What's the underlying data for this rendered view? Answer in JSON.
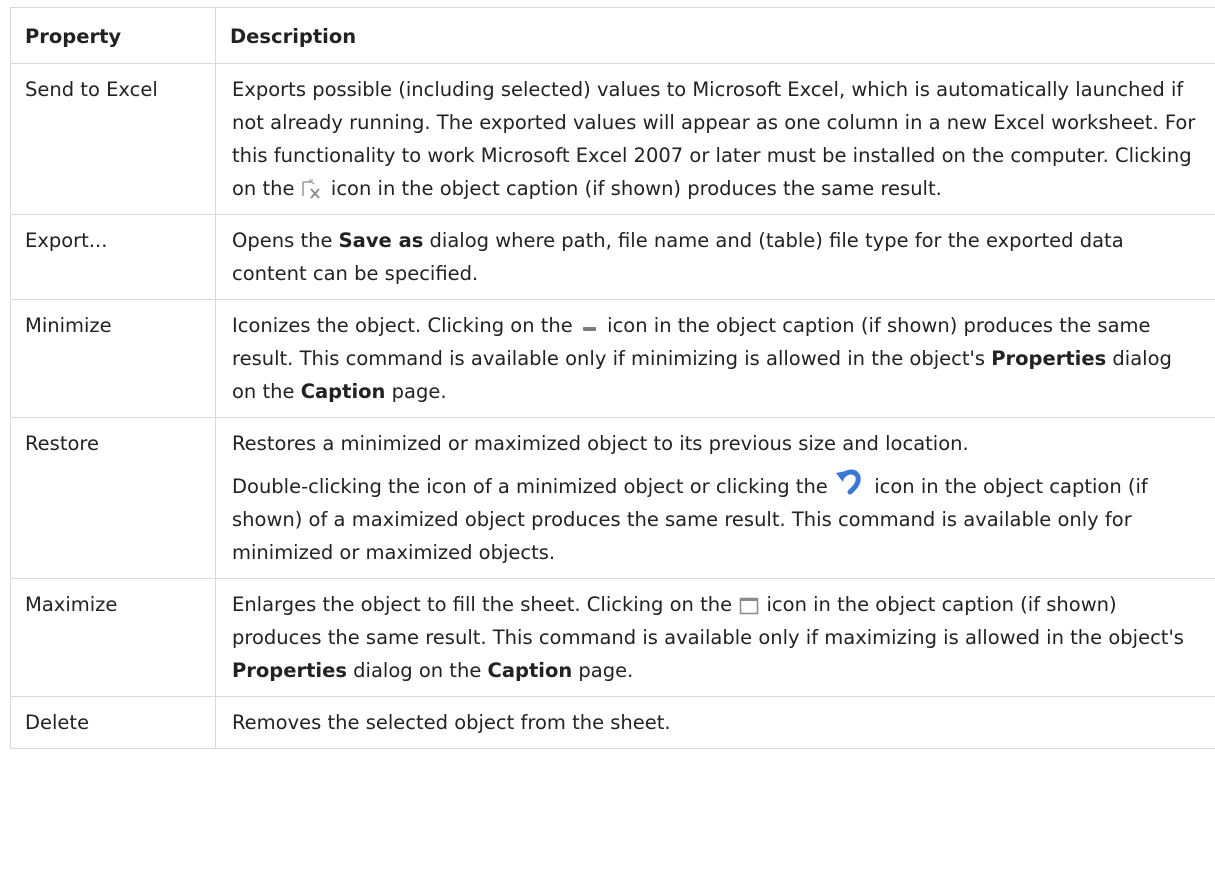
{
  "table": {
    "headers": {
      "property": "Property",
      "description": "Description"
    },
    "rows": [
      {
        "property": "Send to Excel",
        "text": [
          "Exports possible (including selected) values to Microsoft Excel, which is automatically launched if not already running. The exported values will appear as one column in a new Excel worksheet. For this functionality to work Microsoft Excel 2007 or later must be installed on the computer. Clicking on the ",
          " icon in the object caption (if shown) produces the same result."
        ],
        "icon": "send-to-excel-icon"
      },
      {
        "property": "Export...",
        "text": [
          "Opens the ",
          "Save as",
          " dialog where path, file name and (table) file type for the exported data content can be specified."
        ]
      },
      {
        "property": "Minimize",
        "text": [
          "Iconizes the object. Clicking on the ",
          " icon in the object caption (if shown) produces the same result. This command is available only if minimizing is allowed in the object's ",
          "Properties",
          " dialog on the ",
          "Caption",
          " page."
        ],
        "icon": "minimize-icon"
      },
      {
        "property": "Restore",
        "text": [
          "Restores a minimized or maximized object to its previous size and location.",
          "Double-clicking the icon of a minimized object or clicking the ",
          " icon in the object caption (if shown) of a maximized object produces the same result. This command is available only for minimized or maximized objects."
        ],
        "icon": "restore-icon"
      },
      {
        "property": "Maximize",
        "text": [
          "Enlarges the object to fill the sheet. Clicking on the ",
          " icon in the object caption (if shown) produces the same result. This command is available only if maximizing is allowed in the object's ",
          "Properties",
          " dialog on the ",
          "Caption",
          " page."
        ],
        "icon": "maximize-icon"
      },
      {
        "property": "Delete",
        "text": [
          "Removes the selected object from the sheet."
        ]
      }
    ]
  },
  "colors": {
    "border": "#d9d9d9",
    "text": "#222222",
    "restore_icon": "#3a78d8"
  }
}
